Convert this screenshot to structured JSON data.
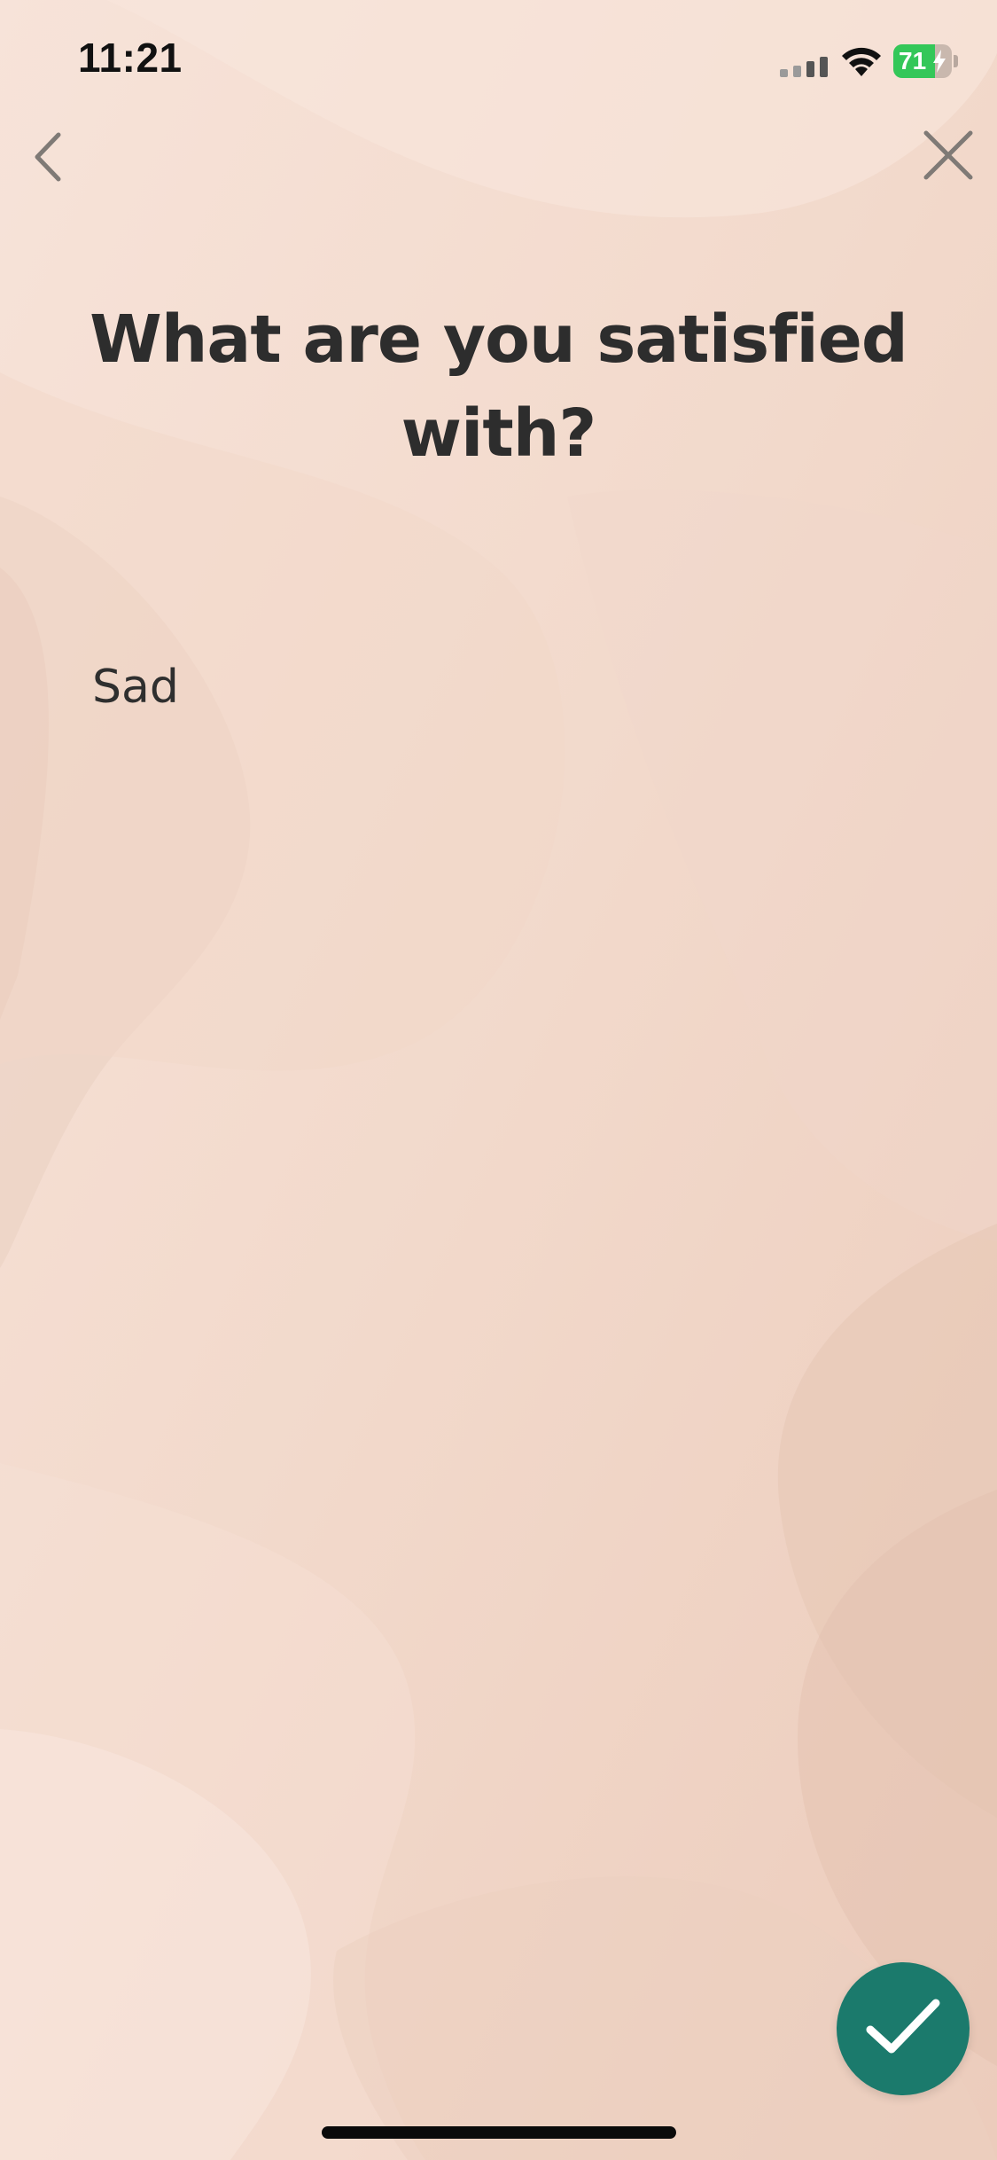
{
  "status_bar": {
    "time": "11:21",
    "battery_level": "71",
    "battery_fraction": 0.71,
    "battery_color": "#34c759"
  },
  "nav": {
    "back_icon": "chevron-left-icon",
    "close_icon": "close-icon"
  },
  "question": {
    "title": "What are you satisfied with?"
  },
  "mood": {
    "label": "Sad"
  },
  "actions": {
    "confirm_icon": "checkmark-icon",
    "confirm_color": "#1b7a6c"
  },
  "theme": {
    "background": "#f3dccf",
    "text_color": "#2d2d2d"
  }
}
